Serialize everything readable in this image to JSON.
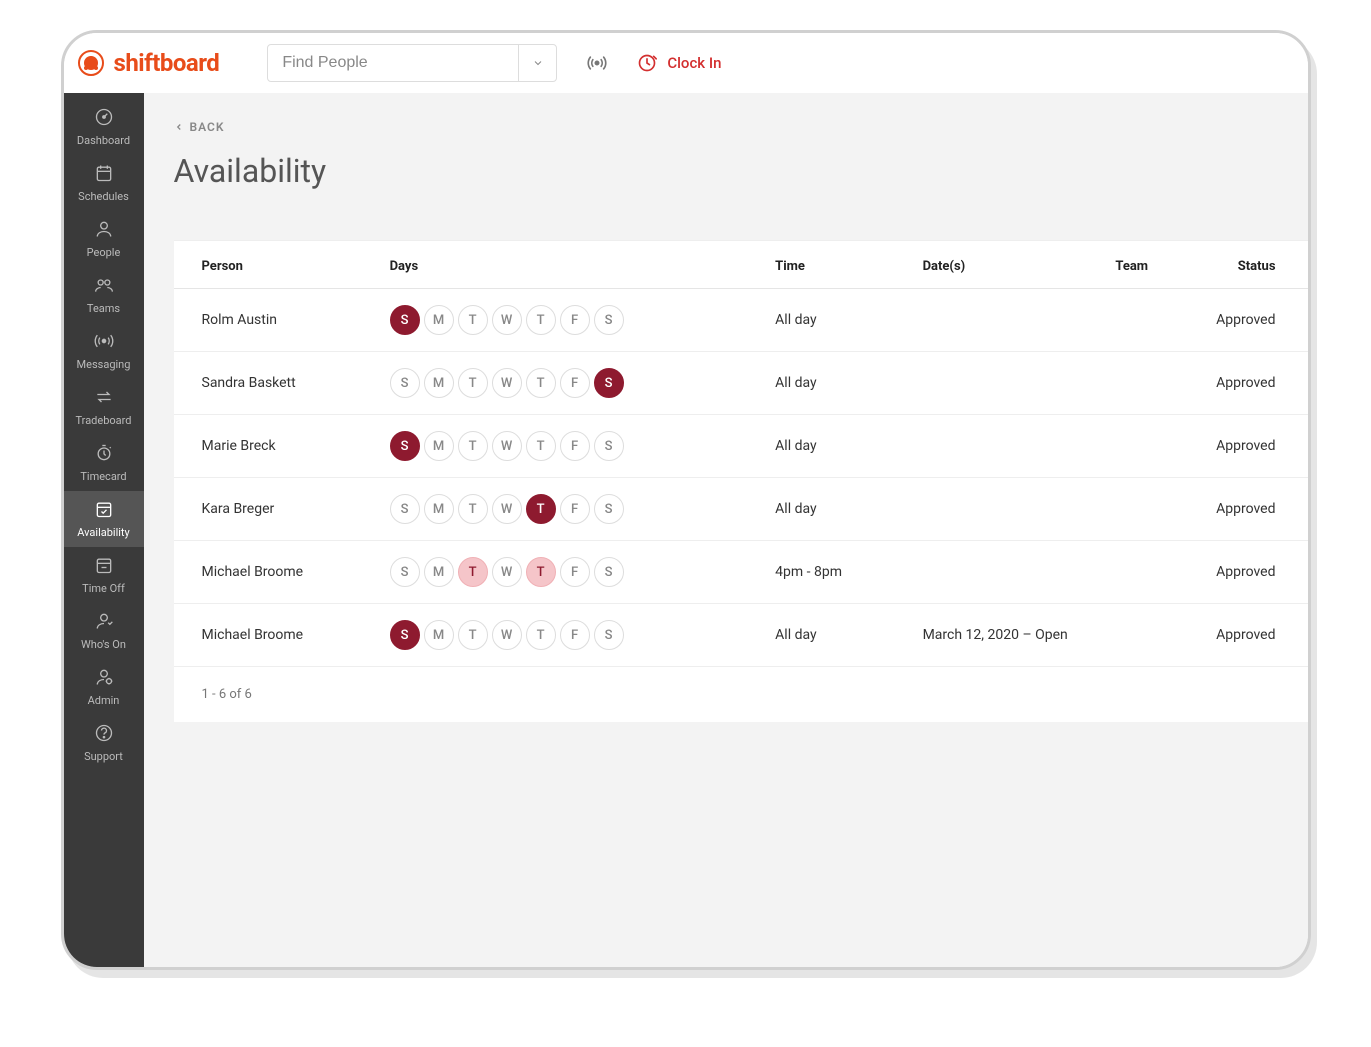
{
  "brand": "shiftboard",
  "header": {
    "search_placeholder": "Find People",
    "clock_in_label": "Clock In"
  },
  "sidebar": {
    "items": [
      {
        "id": "dashboard",
        "label": "Dashboard"
      },
      {
        "id": "schedules",
        "label": "Schedules"
      },
      {
        "id": "people",
        "label": "People"
      },
      {
        "id": "teams",
        "label": "Teams"
      },
      {
        "id": "messaging",
        "label": "Messaging"
      },
      {
        "id": "tradeboard",
        "label": "Tradeboard"
      },
      {
        "id": "timecard",
        "label": "Timecard"
      },
      {
        "id": "availability",
        "label": "Availability"
      },
      {
        "id": "timeoff",
        "label": "Time Off"
      },
      {
        "id": "whoson",
        "label": "Who's On"
      },
      {
        "id": "admin",
        "label": "Admin"
      },
      {
        "id": "support",
        "label": "Support"
      }
    ],
    "active": "availability"
  },
  "page": {
    "back_label": "BACK",
    "title": "Availability",
    "pagination": "1 - 6 of 6"
  },
  "table": {
    "columns": [
      "Person",
      "Days",
      "Time",
      "Date(s)",
      "Team",
      "Status"
    ],
    "day_letters": [
      "S",
      "M",
      "T",
      "W",
      "T",
      "F",
      "S"
    ],
    "rows": [
      {
        "person": "Rolm Austin",
        "days": [
          "selected",
          "",
          "",
          "",
          "",
          "",
          ""
        ],
        "time": "All day",
        "dates": "",
        "team": "",
        "status": "Approved"
      },
      {
        "person": "Sandra Baskett",
        "days": [
          "",
          "",
          "",
          "",
          "",
          "",
          "selected"
        ],
        "time": "All day",
        "dates": "",
        "team": "",
        "status": "Approved"
      },
      {
        "person": "Marie Breck",
        "days": [
          "selected",
          "",
          "",
          "",
          "",
          "",
          ""
        ],
        "time": "All day",
        "dates": "",
        "team": "",
        "status": "Approved"
      },
      {
        "person": "Kara Breger",
        "days": [
          "",
          "",
          "",
          "",
          "selected",
          "",
          ""
        ],
        "time": "All day",
        "dates": "",
        "team": "",
        "status": "Approved"
      },
      {
        "person": "Michael Broome",
        "days": [
          "",
          "",
          "overlap",
          "",
          "overlap",
          "",
          ""
        ],
        "time": "4pm - 8pm",
        "dates": "",
        "team": "",
        "status": "Approved"
      },
      {
        "person": "Michael Broome",
        "days": [
          "selected",
          "",
          "",
          "",
          "",
          "",
          ""
        ],
        "time": "All day",
        "dates": "March 12, 2020 – Open",
        "team": "",
        "status": "Approved"
      }
    ]
  }
}
